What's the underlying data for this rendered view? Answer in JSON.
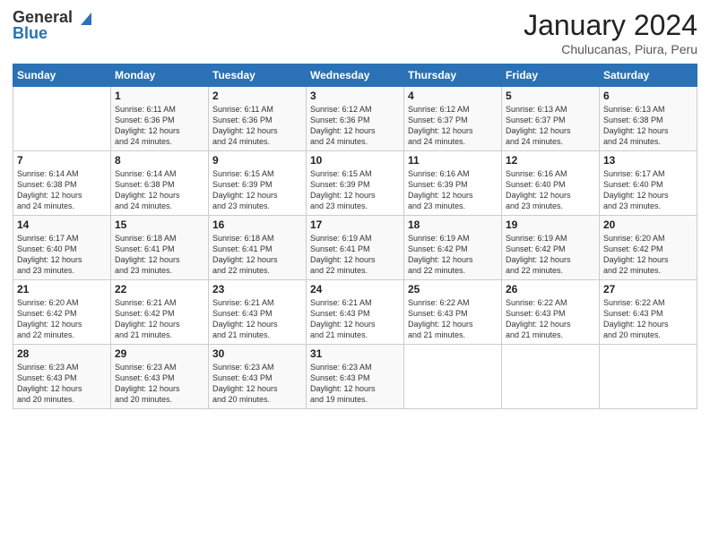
{
  "logo": {
    "line1": "General",
    "line2": "Blue"
  },
  "title": "January 2024",
  "subtitle": "Chulucanas, Piura, Peru",
  "headers": [
    "Sunday",
    "Monday",
    "Tuesday",
    "Wednesday",
    "Thursday",
    "Friday",
    "Saturday"
  ],
  "weeks": [
    [
      {
        "day": "",
        "info": ""
      },
      {
        "day": "1",
        "info": "Sunrise: 6:11 AM\nSunset: 6:36 PM\nDaylight: 12 hours\nand 24 minutes."
      },
      {
        "day": "2",
        "info": "Sunrise: 6:11 AM\nSunset: 6:36 PM\nDaylight: 12 hours\nand 24 minutes."
      },
      {
        "day": "3",
        "info": "Sunrise: 6:12 AM\nSunset: 6:36 PM\nDaylight: 12 hours\nand 24 minutes."
      },
      {
        "day": "4",
        "info": "Sunrise: 6:12 AM\nSunset: 6:37 PM\nDaylight: 12 hours\nand 24 minutes."
      },
      {
        "day": "5",
        "info": "Sunrise: 6:13 AM\nSunset: 6:37 PM\nDaylight: 12 hours\nand 24 minutes."
      },
      {
        "day": "6",
        "info": "Sunrise: 6:13 AM\nSunset: 6:38 PM\nDaylight: 12 hours\nand 24 minutes."
      }
    ],
    [
      {
        "day": "7",
        "info": "Sunrise: 6:14 AM\nSunset: 6:38 PM\nDaylight: 12 hours\nand 24 minutes."
      },
      {
        "day": "8",
        "info": "Sunrise: 6:14 AM\nSunset: 6:38 PM\nDaylight: 12 hours\nand 24 minutes."
      },
      {
        "day": "9",
        "info": "Sunrise: 6:15 AM\nSunset: 6:39 PM\nDaylight: 12 hours\nand 23 minutes."
      },
      {
        "day": "10",
        "info": "Sunrise: 6:15 AM\nSunset: 6:39 PM\nDaylight: 12 hours\nand 23 minutes."
      },
      {
        "day": "11",
        "info": "Sunrise: 6:16 AM\nSunset: 6:39 PM\nDaylight: 12 hours\nand 23 minutes."
      },
      {
        "day": "12",
        "info": "Sunrise: 6:16 AM\nSunset: 6:40 PM\nDaylight: 12 hours\nand 23 minutes."
      },
      {
        "day": "13",
        "info": "Sunrise: 6:17 AM\nSunset: 6:40 PM\nDaylight: 12 hours\nand 23 minutes."
      }
    ],
    [
      {
        "day": "14",
        "info": "Sunrise: 6:17 AM\nSunset: 6:40 PM\nDaylight: 12 hours\nand 23 minutes."
      },
      {
        "day": "15",
        "info": "Sunrise: 6:18 AM\nSunset: 6:41 PM\nDaylight: 12 hours\nand 23 minutes."
      },
      {
        "day": "16",
        "info": "Sunrise: 6:18 AM\nSunset: 6:41 PM\nDaylight: 12 hours\nand 22 minutes."
      },
      {
        "day": "17",
        "info": "Sunrise: 6:19 AM\nSunset: 6:41 PM\nDaylight: 12 hours\nand 22 minutes."
      },
      {
        "day": "18",
        "info": "Sunrise: 6:19 AM\nSunset: 6:42 PM\nDaylight: 12 hours\nand 22 minutes."
      },
      {
        "day": "19",
        "info": "Sunrise: 6:19 AM\nSunset: 6:42 PM\nDaylight: 12 hours\nand 22 minutes."
      },
      {
        "day": "20",
        "info": "Sunrise: 6:20 AM\nSunset: 6:42 PM\nDaylight: 12 hours\nand 22 minutes."
      }
    ],
    [
      {
        "day": "21",
        "info": "Sunrise: 6:20 AM\nSunset: 6:42 PM\nDaylight: 12 hours\nand 22 minutes."
      },
      {
        "day": "22",
        "info": "Sunrise: 6:21 AM\nSunset: 6:42 PM\nDaylight: 12 hours\nand 21 minutes."
      },
      {
        "day": "23",
        "info": "Sunrise: 6:21 AM\nSunset: 6:43 PM\nDaylight: 12 hours\nand 21 minutes."
      },
      {
        "day": "24",
        "info": "Sunrise: 6:21 AM\nSunset: 6:43 PM\nDaylight: 12 hours\nand 21 minutes."
      },
      {
        "day": "25",
        "info": "Sunrise: 6:22 AM\nSunset: 6:43 PM\nDaylight: 12 hours\nand 21 minutes."
      },
      {
        "day": "26",
        "info": "Sunrise: 6:22 AM\nSunset: 6:43 PM\nDaylight: 12 hours\nand 21 minutes."
      },
      {
        "day": "27",
        "info": "Sunrise: 6:22 AM\nSunset: 6:43 PM\nDaylight: 12 hours\nand 20 minutes."
      }
    ],
    [
      {
        "day": "28",
        "info": "Sunrise: 6:23 AM\nSunset: 6:43 PM\nDaylight: 12 hours\nand 20 minutes."
      },
      {
        "day": "29",
        "info": "Sunrise: 6:23 AM\nSunset: 6:43 PM\nDaylight: 12 hours\nand 20 minutes."
      },
      {
        "day": "30",
        "info": "Sunrise: 6:23 AM\nSunset: 6:43 PM\nDaylight: 12 hours\nand 20 minutes."
      },
      {
        "day": "31",
        "info": "Sunrise: 6:23 AM\nSunset: 6:43 PM\nDaylight: 12 hours\nand 19 minutes."
      },
      {
        "day": "",
        "info": ""
      },
      {
        "day": "",
        "info": ""
      },
      {
        "day": "",
        "info": ""
      }
    ]
  ]
}
